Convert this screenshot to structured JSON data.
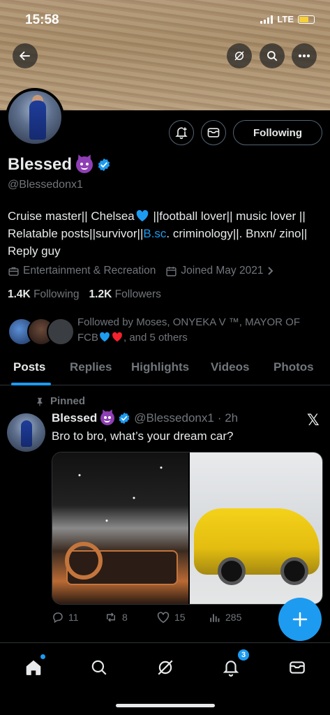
{
  "status": {
    "time": "15:58",
    "network": "LTE"
  },
  "profile": {
    "name": "Blessed",
    "handle": "@Blessedonx1",
    "follow_label": "Following",
    "bio_part1": "Cruise master|| Chelsea",
    "bio_part2": " ||football lover|| music lover || Relatable posts||survivor||",
    "bio_link": "B.sc",
    "bio_part3": ". criminology||. Bnxn/ zino|| Reply guy",
    "category": "Entertainment & Recreation",
    "joined": "Joined May 2021",
    "following_count": "1.4K",
    "following_label": "Following",
    "followers_count": "1.2K",
    "followers_label": "Followers",
    "followed_by_prefix": "Followed by Moses, ONYEKA V ™, MAYOR OF FCB",
    "followed_by_suffix": ", and 5 others"
  },
  "tabs": [
    "Posts",
    "Replies",
    "Highlights",
    "Videos",
    "Photos"
  ],
  "post": {
    "pinned_label": "Pinned",
    "name": "Blessed",
    "handle": "@Blessedonx1",
    "time": "· 2h",
    "text": "Bro to bro, what’s your dream car?",
    "replies": "11",
    "reposts": "8",
    "likes": "15",
    "views": "285"
  },
  "nav": {
    "notifications_badge": "3"
  },
  "colors": {
    "accent": "#1d9bf0",
    "background": "#000000",
    "muted": "#71767b"
  }
}
